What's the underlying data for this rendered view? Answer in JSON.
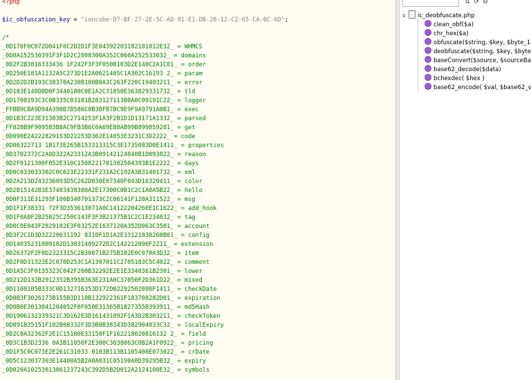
{
  "editor": {
    "php_open_tag": "<?php",
    "key_var": "$ic_obfuscation_key",
    "key_eq": " = ",
    "key_value": "\"ioncube-D7-BF-27-2E-5C-AD-91-E1-DB-28-12-C2-65-CA-BC-6D\"",
    "key_end": ";",
    "comment_open": "/*",
    "lines": [
      {
        "hash": "_0D170F0C072D041F0C2D2D1F3E04392203182101012E32_",
        "word": "WHMCS"
      },
      {
        "hash": "_0D0A152530391F3F1D2C2808300A352C060A252533032_",
        "word": "domains"
      },
      {
        "hash": "_0D2F2B3816333436 1F242F3F3F0508103D2E140C2A1C01_",
        "word": "order"
      },
      {
        "hash": "_0D250E181A1132A5C273D1E2A0621405C1A302C16193 2_",
        "word": "param"
      },
      {
        "hash": "_0D2D2D2B193C38370A230B100B0A3C263F220C19403211_",
        "word": "error"
      },
      {
        "hash": "_0D103E140D0D0F3440180C0E1A2C31050E363829331732_",
        "word": "tld"
      },
      {
        "hash": "_0D1708193C3C0B335C03181B283127113B0A0C09191C22_",
        "word": "logger"
      },
      {
        "hash": "_FFBB9CBA9D94A390B7B586C0B3BFB7BC9E9F9A9791A0B1_",
        "word": "exec"
      },
      {
        "hash": "_0D1B3C223E31303B2C2714253F1A3F2B1D1D13171A1332_",
        "word": "parsed"
      },
      {
        "hash": "_FF828B9F909583B8AC9FB3B6C0A69E88AB99B899859281_",
        "word": "get"
      },
      {
        "hash": "_0D090E24222829153D22253D362E14053E3231C3D2222_",
        "word": "code"
      },
      {
        "hash": "_0D06322713 1B173E265B153313315C3E1735083D0E1411_",
        "word": "properties"
      },
      {
        "hash": "_0D3702372C2A0D322A23312A3B09142124040B1D093822_",
        "word": "reason"
      },
      {
        "hash": "_0D2F0121300F052E310C1508221701382504393B1E2222_",
        "word": "days"
      },
      {
        "hash": "_0D0C033033302C0C023E22331F231A2C192A3B31401732_",
        "word": "xml"
      },
      {
        "hash": "_0D2A213D243236093D5C262D030E07340F043D16320411_",
        "word": "color"
      },
      {
        "hash": "_0D2B15142B3E37403438380A2E17300C0B1C2C1A0A5B22_",
        "word": "hello"
      },
      {
        "hash": "_0D0F311E31293F100B340701373C2C06141F120A311522_",
        "word": "msg"
      },
      {
        "hash": "_0D1F1F38331 72F3D353613071A0C14122204260E1C1622_",
        "word": "add_hook"
      },
      {
        "hash": "_0D1F0A0F2B25025C250C143F3F3B21375B1C2C1E234032_",
        "word": "tag"
      },
      {
        "hash": "_0D0C0E043F2829102E3F03252E1637120A352D063C3501_",
        "word": "account"
      },
      {
        "hash": "_0D3F2C1D3D32220631192 8310F1D1A2E33121830260B01_",
        "word": "config"
      },
      {
        "hash": "_0D14035231009102D13031409272D2C142212090F2211_",
        "word": "extension"
      },
      {
        "hash": "_0D26372F2F0D2323315C2B30071B275B182E0C070A3D32_",
        "word": "item"
      },
      {
        "hash": "_0D2F0D31323E2C070D253C1A1307011C2705183C5C4022_",
        "word": "comment"
      },
      {
        "hash": "_0D1A5C3F0135323C042F260B32292E2E1E3340361B2301_",
        "word": "lower"
      },
      {
        "hash": "_0D212D132B2912352B395B363E231A0C37050F2D361D22_",
        "word": "mixed"
      },
      {
        "hash": "_0D1108105B333C0D132716353D172D02292502080F1411_",
        "word": "checkDate"
      },
      {
        "hash": "_0D0B3F3026173B155B3D110B132922361F183708282D01_",
        "word": "expiration"
      },
      {
        "hash": "_0D0B0E3013041204052F0F050E31365B1827355B393911_",
        "word": "md5Hash"
      },
      {
        "hash": "_0D1906132339321C3D162E3D161431092F1A3D2B303211_",
        "word": "checkToken"
      },
      {
        "hash": "_0D091B35151F182B08332F3D3B0B38343D382904033C32_",
        "word": "localExpiry"
      },
      {
        "hash": "_0D2C0A32362F2E1C15180E33150F1F162218020816132 2_",
        "word": "field"
      },
      {
        "hash": "_0D3C1B3D2336 0A3B11050F2E300C3638063C0B2A1F0922_",
        "word": "pricing"
      },
      {
        "hash": "_0D1F5C0C073E2E261C31033 0103B113B1105400E073022_",
        "word": "crDate"
      },
      {
        "hash": "_0D5C123037303E14400A5B2A0A031C05190A0D39295B32_",
        "word": "expiry"
      },
      {
        "hash": "_0D020A10253013061237243C392D5B2D012A2124100E32_",
        "word": "symbols"
      }
    ],
    "separator": " = "
  },
  "panel": {
    "root_file": "ic_deobfuscate.php",
    "items": [
      "clean_obf($a)",
      "chr_hex($a)",
      "obfuscate($string, $key, $byte_1 = 1",
      "deobfuscate($string, $key, $byte_1",
      "baseConvert($source, $sourceBase,",
      "base62_decode($data)",
      "bchexdec( $hex )",
      "base62_encode( $val, $base62_vals"
    ],
    "colors": {
      "function_icon": "#a05ad6",
      "php_keyword": "#c80000",
      "string": "#808080",
      "comment": "#008000",
      "variable": "#000080"
    }
  }
}
